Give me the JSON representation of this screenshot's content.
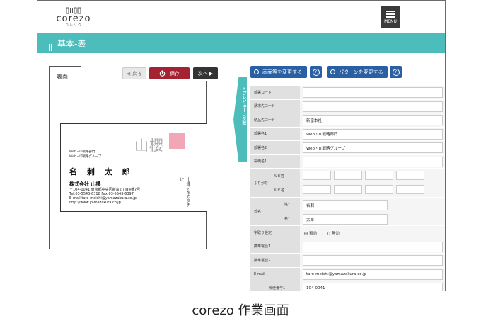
{
  "app": {
    "logo_text": "corezo",
    "logo_sub": "コレゾウ",
    "menu_label": "MENU"
  },
  "page_title": "基本-表",
  "left_panel": {
    "tab_label": "表面",
    "back_label": "戻る",
    "save_label": "保存",
    "next_label": "次へ ▶",
    "preview_label": "« プレビューに反映"
  },
  "business_card": {
    "division1": "Web・IT戦略部門",
    "division2": "Web・IT戦略グループ",
    "name": "名 刺 太 郎",
    "company": "株式会社 山櫻",
    "address": "〒104-0041 東京都中央区新富2丁目4番7号",
    "tel": "Tel:03-5543-6318    Fax:03-5543-6397",
    "email": "E-mail:taro-meishi@yamazakura.co.jp",
    "url": "http://www.yamazakura.co.jp",
    "logo_text": "山櫻",
    "vertical_text": "出逢いをカタチに"
  },
  "right_panel": {
    "btn_change_image": "画面等を変更する",
    "btn_change_pattern": "パターンを変更する",
    "help_symbol": "?"
  },
  "form": {
    "fields": [
      {
        "label": "部署コード",
        "value": ""
      },
      {
        "label": "請求先コード",
        "value": ""
      },
      {
        "label": "納品先コード",
        "value": "新富本社"
      },
      {
        "label": "部署名1",
        "value": "Web・IT戦略部門"
      },
      {
        "label": "部署名2",
        "value": "Web・IT戦略グループ"
      },
      {
        "label": "役職名1",
        "value": ""
      }
    ],
    "furigana": {
      "label": "ふりがな",
      "sub_sei": "ルビ姓",
      "sub_mei": "ルビ名"
    },
    "name": {
      "label": "氏名",
      "sei_label": "姓",
      "sei_value": "名刺",
      "mei_label": "名",
      "mei_value": "太郎",
      "required_mark": "*"
    },
    "reading": {
      "label": "字取り設定",
      "option_on": "有効",
      "option_off": "無効"
    },
    "more_fields": [
      {
        "label": "携帯電話1",
        "value": ""
      },
      {
        "label": "携帯電話2",
        "value": ""
      },
      {
        "label": "E-mail",
        "value": "taro-meishi@yamazakura.co.jp"
      },
      {
        "label": "郵便番号1",
        "value": "104-0041"
      }
    ]
  },
  "caption": "corezo 作業画面",
  "colors": {
    "teal": "#4dbdbb",
    "save_red": "#a52232",
    "blue_button": "#2b5fa4",
    "logo_pink": "#f2a7b6"
  }
}
